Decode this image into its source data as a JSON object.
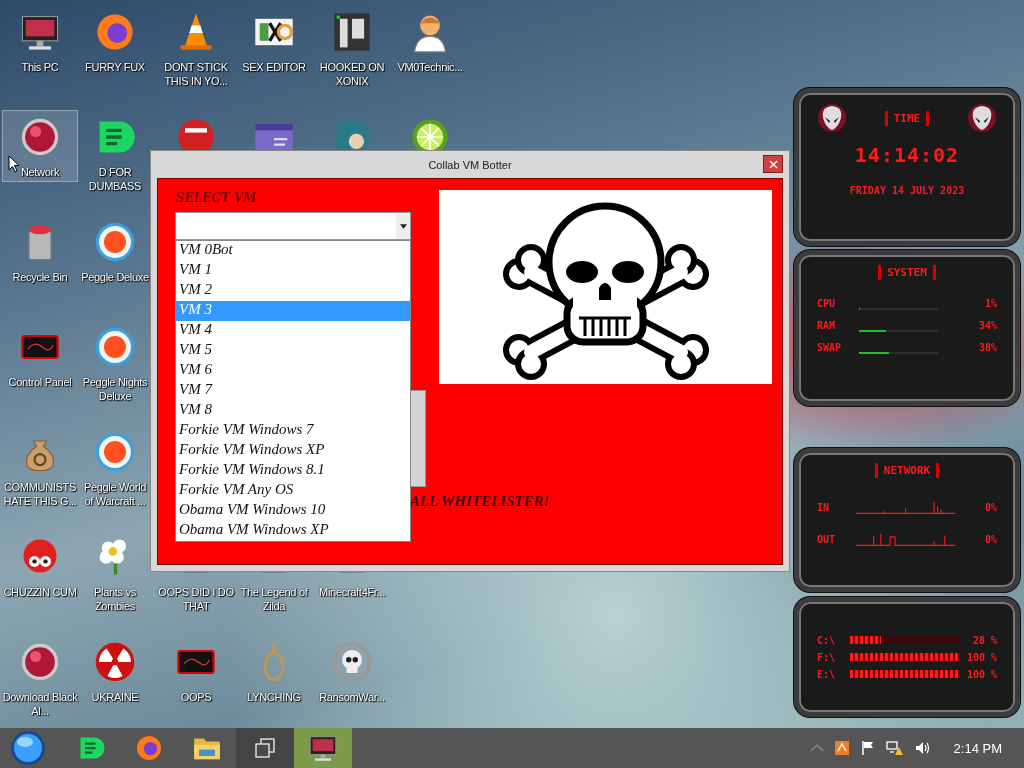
{
  "desktop_icons": [
    {
      "label": "This PC",
      "selected": false
    },
    {
      "label": "FURRY FUX",
      "selected": false
    },
    {
      "label": "DONT STICK THIS IN YO...",
      "selected": false
    },
    {
      "label": "SEX EDITOR",
      "selected": false
    },
    {
      "label": "HOOKED ON XONIX",
      "selected": false
    },
    {
      "label": "VM0Technic...",
      "selected": false
    },
    {
      "label": "Network",
      "selected": true
    },
    {
      "label": "D FOR DUMBASS",
      "selected": false
    },
    {
      "label": "Recycle Bin",
      "selected": false
    },
    {
      "label": "Peggle Deluxe",
      "selected": false
    },
    {
      "label": "Control Panel",
      "selected": false
    },
    {
      "label": "Peggle Nights Deluxe",
      "selected": false
    },
    {
      "label": "COMMUNISTS HATE THIS G...",
      "selected": false
    },
    {
      "label": "Peggle World of Warcraft ...",
      "selected": false
    },
    {
      "label": "CHUZZIN CUM",
      "selected": false
    },
    {
      "label": "Plants vs Zombies",
      "selected": false
    },
    {
      "label": "OOPS DID I DO THAT",
      "selected": false
    },
    {
      "label": "The Legend of Zilda",
      "selected": false
    },
    {
      "label": "Minecraft4Fr...",
      "selected": false
    },
    {
      "label": "Download Black Al...",
      "selected": false
    },
    {
      "label": "UKRAINE",
      "selected": false
    },
    {
      "label": "OOPS",
      "selected": false
    },
    {
      "label": "LYNCHING",
      "selected": false
    },
    {
      "label": "RansomWar...",
      "selected": false
    }
  ],
  "window": {
    "title": "Collab VM Botter",
    "select_label": "SELECT VM",
    "banner_text": "ALL WHITELISTER!",
    "options": [
      {
        "label": "VM 0Bot",
        "selected": false
      },
      {
        "label": "VM 1",
        "selected": false
      },
      {
        "label": "VM 2",
        "selected": false
      },
      {
        "label": "VM 3",
        "selected": true
      },
      {
        "label": "VM 4",
        "selected": false
      },
      {
        "label": "VM 5",
        "selected": false
      },
      {
        "label": "VM 6",
        "selected": false
      },
      {
        "label": "VM 7",
        "selected": false
      },
      {
        "label": "VM 8",
        "selected": false
      },
      {
        "label": "Forkie VM Windows 7",
        "selected": false
      },
      {
        "label": "Forkie VM Windows XP",
        "selected": false
      },
      {
        "label": "Forkie VM Windows 8.1",
        "selected": false
      },
      {
        "label": "Forkie VM Any OS",
        "selected": false
      },
      {
        "label": "Obama VM Windows 10",
        "selected": false
      },
      {
        "label": "Obama VM Windows XP",
        "selected": false
      }
    ]
  },
  "clock_widget": {
    "title": "TIME",
    "time": "14:14:02",
    "date": "FRIDAY 14 JULY 2023"
  },
  "system_widget": {
    "title": "SYSTEM",
    "rows": [
      {
        "label": "CPU",
        "level": 0.01,
        "reading": "1%"
      },
      {
        "label": "RAM",
        "level": 0.34,
        "reading": "34%"
      },
      {
        "label": "SWAP",
        "level": 0.38,
        "reading": "38%"
      }
    ]
  },
  "network_widget": {
    "title": "NETWORK",
    "rows": [
      {
        "label": "IN",
        "reading": "0%"
      },
      {
        "label": "OUT",
        "reading": "0%"
      }
    ]
  },
  "drives_widget": {
    "rows": [
      {
        "label": "C:\\",
        "level": 0.28,
        "reading": "28 %"
      },
      {
        "label": "F:\\",
        "level": 1,
        "reading": "100 %"
      },
      {
        "label": "E:\\",
        "level": 1,
        "reading": "100 %"
      }
    ]
  },
  "taskbar": {
    "clock": "2:14 PM",
    "apps": [
      {
        "active": false
      },
      {
        "active": false
      },
      {
        "active": false
      },
      {
        "active": true
      }
    ]
  }
}
